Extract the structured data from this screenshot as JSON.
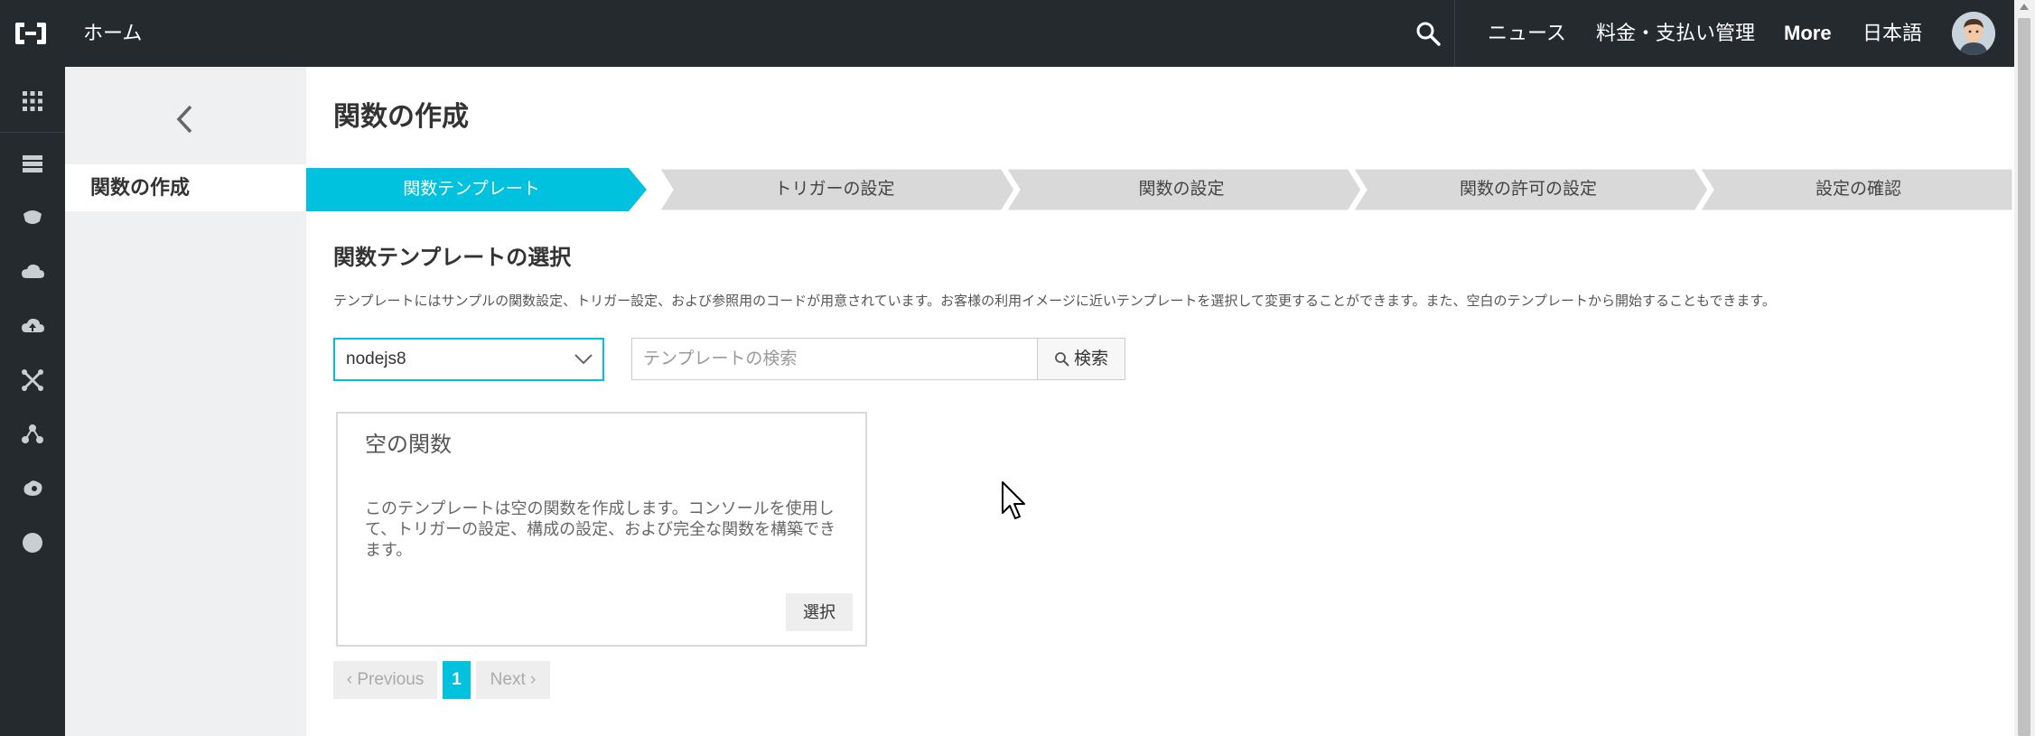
{
  "topbar": {
    "home_label": "ホーム",
    "nav": [
      "ニュース",
      "料金・支払い管理",
      "More",
      "日本語"
    ]
  },
  "sidebar": {
    "active_label": "関数の作成"
  },
  "page": {
    "title": "関数の作成"
  },
  "steps": [
    "関数テンプレート",
    "トリガーの設定",
    "関数の設定",
    "関数の許可の設定",
    "設定の確認"
  ],
  "section": {
    "title": "関数テンプレートの選択",
    "description": "テンプレートにはサンプルの関数設定、トリガー設定、および参照用のコードが用意されています。お客様の利用イメージに近いテンプレートを選択して変更することができます。また、空白のテンプレートから開始することもできます。"
  },
  "filters": {
    "runtime_selected": "nodejs8",
    "search_placeholder": "テンプレートの検索",
    "search_button": "検索"
  },
  "templates": [
    {
      "title": "空の関数",
      "description": "このテンプレートは空の関数を作成します。コンソールを使用して、トリガーの設定、構成の設定、および完全な関数を構築できます。",
      "select_label": "選択"
    }
  ],
  "pagination": {
    "previous": "Previous",
    "current": "1",
    "next": "Next"
  },
  "colors": {
    "topbar": "#252a2f",
    "accent": "#00c1de",
    "step_inactive": "#d9d9d9"
  }
}
